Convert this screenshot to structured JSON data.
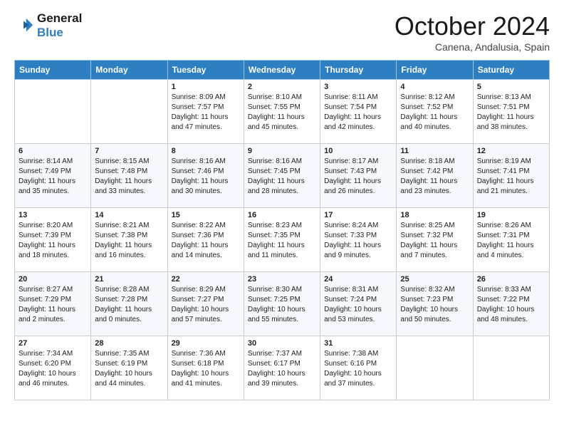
{
  "header": {
    "logo_line1": "General",
    "logo_line2": "Blue",
    "month": "October 2024",
    "location": "Canena, Andalusia, Spain"
  },
  "days_of_week": [
    "Sunday",
    "Monday",
    "Tuesday",
    "Wednesday",
    "Thursday",
    "Friday",
    "Saturday"
  ],
  "weeks": [
    [
      {
        "day": "",
        "detail": ""
      },
      {
        "day": "",
        "detail": ""
      },
      {
        "day": "1",
        "detail": "Sunrise: 8:09 AM\nSunset: 7:57 PM\nDaylight: 11 hours and 47 minutes."
      },
      {
        "day": "2",
        "detail": "Sunrise: 8:10 AM\nSunset: 7:55 PM\nDaylight: 11 hours and 45 minutes."
      },
      {
        "day": "3",
        "detail": "Sunrise: 8:11 AM\nSunset: 7:54 PM\nDaylight: 11 hours and 42 minutes."
      },
      {
        "day": "4",
        "detail": "Sunrise: 8:12 AM\nSunset: 7:52 PM\nDaylight: 11 hours and 40 minutes."
      },
      {
        "day": "5",
        "detail": "Sunrise: 8:13 AM\nSunset: 7:51 PM\nDaylight: 11 hours and 38 minutes."
      }
    ],
    [
      {
        "day": "6",
        "detail": "Sunrise: 8:14 AM\nSunset: 7:49 PM\nDaylight: 11 hours and 35 minutes."
      },
      {
        "day": "7",
        "detail": "Sunrise: 8:15 AM\nSunset: 7:48 PM\nDaylight: 11 hours and 33 minutes."
      },
      {
        "day": "8",
        "detail": "Sunrise: 8:16 AM\nSunset: 7:46 PM\nDaylight: 11 hours and 30 minutes."
      },
      {
        "day": "9",
        "detail": "Sunrise: 8:16 AM\nSunset: 7:45 PM\nDaylight: 11 hours and 28 minutes."
      },
      {
        "day": "10",
        "detail": "Sunrise: 8:17 AM\nSunset: 7:43 PM\nDaylight: 11 hours and 26 minutes."
      },
      {
        "day": "11",
        "detail": "Sunrise: 8:18 AM\nSunset: 7:42 PM\nDaylight: 11 hours and 23 minutes."
      },
      {
        "day": "12",
        "detail": "Sunrise: 8:19 AM\nSunset: 7:41 PM\nDaylight: 11 hours and 21 minutes."
      }
    ],
    [
      {
        "day": "13",
        "detail": "Sunrise: 8:20 AM\nSunset: 7:39 PM\nDaylight: 11 hours and 18 minutes."
      },
      {
        "day": "14",
        "detail": "Sunrise: 8:21 AM\nSunset: 7:38 PM\nDaylight: 11 hours and 16 minutes."
      },
      {
        "day": "15",
        "detail": "Sunrise: 8:22 AM\nSunset: 7:36 PM\nDaylight: 11 hours and 14 minutes."
      },
      {
        "day": "16",
        "detail": "Sunrise: 8:23 AM\nSunset: 7:35 PM\nDaylight: 11 hours and 11 minutes."
      },
      {
        "day": "17",
        "detail": "Sunrise: 8:24 AM\nSunset: 7:33 PM\nDaylight: 11 hours and 9 minutes."
      },
      {
        "day": "18",
        "detail": "Sunrise: 8:25 AM\nSunset: 7:32 PM\nDaylight: 11 hours and 7 minutes."
      },
      {
        "day": "19",
        "detail": "Sunrise: 8:26 AM\nSunset: 7:31 PM\nDaylight: 11 hours and 4 minutes."
      }
    ],
    [
      {
        "day": "20",
        "detail": "Sunrise: 8:27 AM\nSunset: 7:29 PM\nDaylight: 11 hours and 2 minutes."
      },
      {
        "day": "21",
        "detail": "Sunrise: 8:28 AM\nSunset: 7:28 PM\nDaylight: 11 hours and 0 minutes."
      },
      {
        "day": "22",
        "detail": "Sunrise: 8:29 AM\nSunset: 7:27 PM\nDaylight: 10 hours and 57 minutes."
      },
      {
        "day": "23",
        "detail": "Sunrise: 8:30 AM\nSunset: 7:25 PM\nDaylight: 10 hours and 55 minutes."
      },
      {
        "day": "24",
        "detail": "Sunrise: 8:31 AM\nSunset: 7:24 PM\nDaylight: 10 hours and 53 minutes."
      },
      {
        "day": "25",
        "detail": "Sunrise: 8:32 AM\nSunset: 7:23 PM\nDaylight: 10 hours and 50 minutes."
      },
      {
        "day": "26",
        "detail": "Sunrise: 8:33 AM\nSunset: 7:22 PM\nDaylight: 10 hours and 48 minutes."
      }
    ],
    [
      {
        "day": "27",
        "detail": "Sunrise: 7:34 AM\nSunset: 6:20 PM\nDaylight: 10 hours and 46 minutes."
      },
      {
        "day": "28",
        "detail": "Sunrise: 7:35 AM\nSunset: 6:19 PM\nDaylight: 10 hours and 44 minutes."
      },
      {
        "day": "29",
        "detail": "Sunrise: 7:36 AM\nSunset: 6:18 PM\nDaylight: 10 hours and 41 minutes."
      },
      {
        "day": "30",
        "detail": "Sunrise: 7:37 AM\nSunset: 6:17 PM\nDaylight: 10 hours and 39 minutes."
      },
      {
        "day": "31",
        "detail": "Sunrise: 7:38 AM\nSunset: 6:16 PM\nDaylight: 10 hours and 37 minutes."
      },
      {
        "day": "",
        "detail": ""
      },
      {
        "day": "",
        "detail": ""
      }
    ]
  ]
}
